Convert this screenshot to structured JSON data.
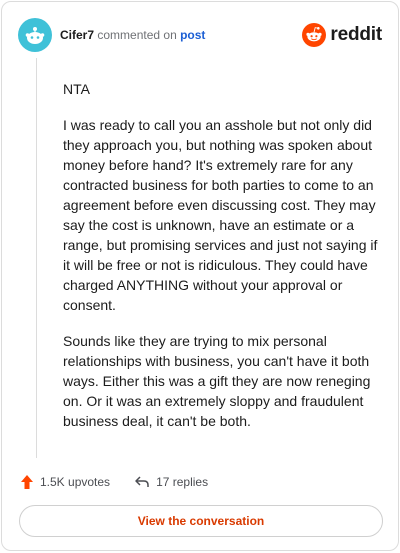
{
  "header": {
    "username": "Cifer7",
    "action_text": "commented on",
    "post_link": "post",
    "brand": "reddit"
  },
  "comment": {
    "paragraphs": [
      "NTA",
      "I was ready to call you an asshole but not only did they approach you, but nothing was spoken about money before hand? It's extremely rare for any contracted business for both parties to come to an agreement before even discussing cost. They may say the cost is unknown, have an estimate or a range, but promising services and just not saying if it will be free or not is ridiculous. They could have charged ANYTHING without your approval or consent.",
      "Sounds like they are trying to mix personal relationships with business, you can't have it both ways. Either this was a gift they are now reneging on. Or it was an extremely sloppy and fraudulent business deal, it can't be both."
    ]
  },
  "actions": {
    "upvotes": "1.5K upvotes",
    "replies": "17 replies"
  },
  "view_button": "View the conversation",
  "colors": {
    "brand_orange": "#ff4500",
    "link_blue": "#1c5fd4",
    "button_text": "#d93a00",
    "avatar_bg": "#3fc1d8"
  },
  "icons": {
    "avatar": "snoo-avatar-icon",
    "brand": "reddit-logo-icon",
    "upvote": "upvote-arrow-icon",
    "reply": "reply-arrow-icon"
  }
}
